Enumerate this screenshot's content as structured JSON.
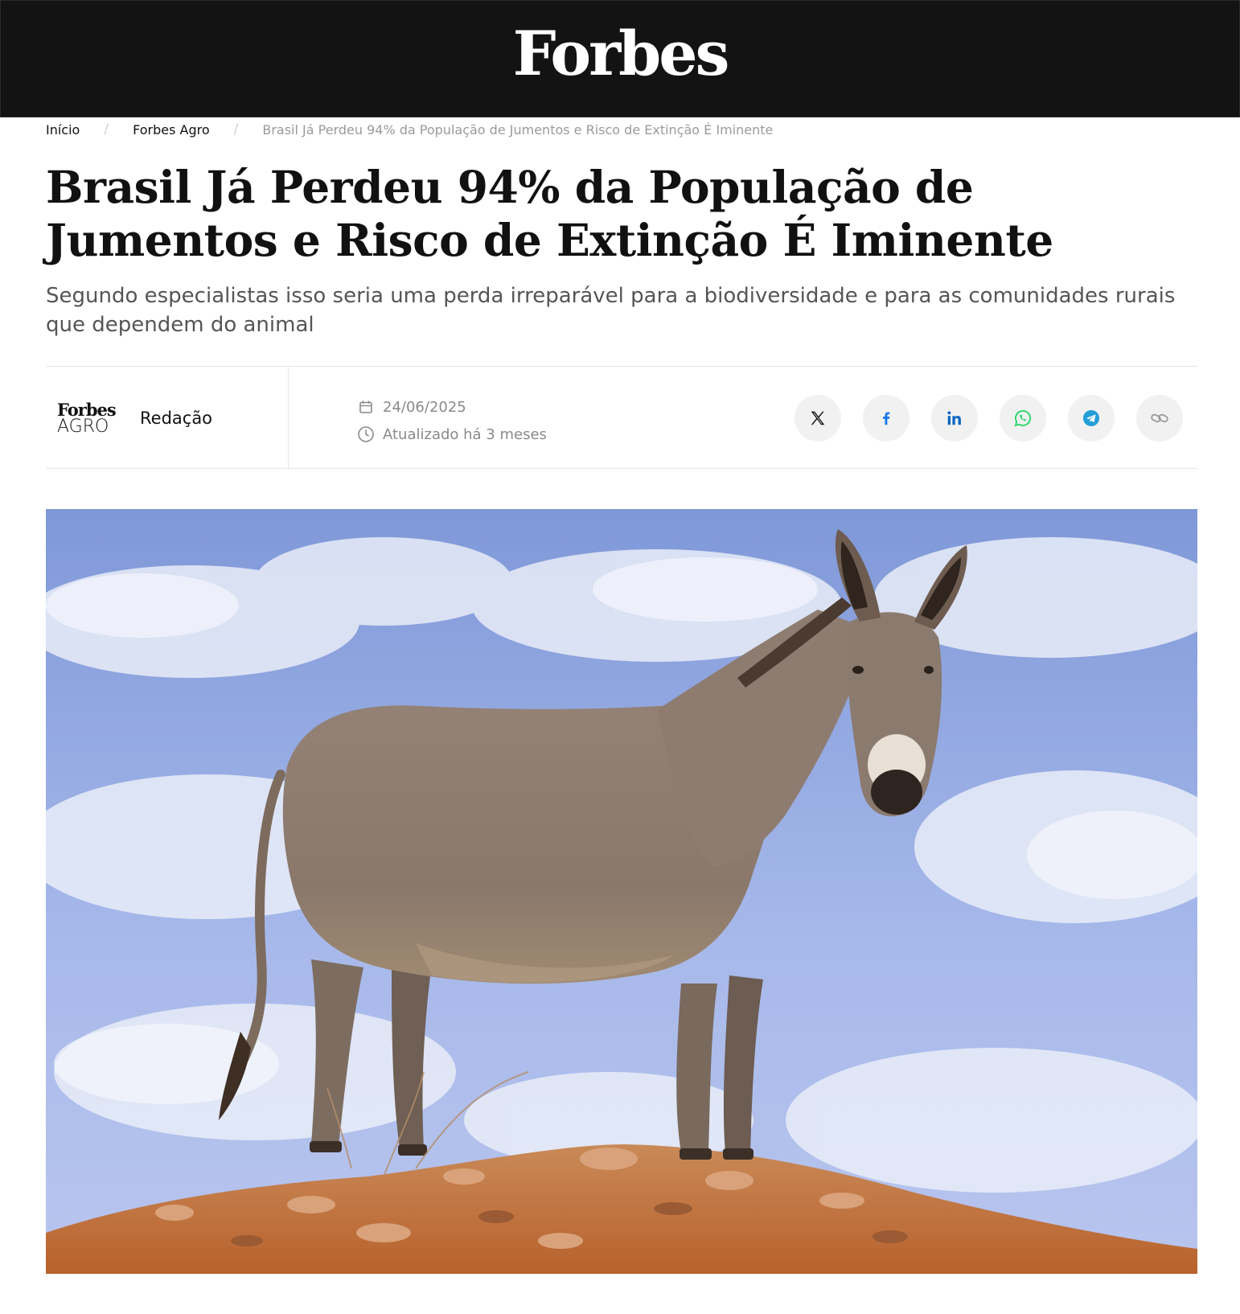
{
  "header": {
    "brand": "Forbes"
  },
  "breadcrumb": {
    "items": [
      {
        "label": "Início"
      },
      {
        "label": "Forbes Agro"
      },
      {
        "label": "Brasil Já Perdeu 94% da População de Jumentos e Risco de Extinção É Iminente"
      }
    ]
  },
  "article": {
    "title": "Brasil Já Perdeu 94% da População de Jumentos e Risco de Extinção É Iminente",
    "subtitle": "Segundo especialistas isso seria uma perda irreparável para a biodiversidade e para as comunidades rurais que dependem do animal",
    "author_logo_line1": "Forbes",
    "author_logo_line2": "AGRO",
    "author": "Redação",
    "date": "24/06/2025",
    "updated": "Atualizado há 3 meses"
  },
  "share": [
    {
      "icon": "x-icon",
      "color": "#111111"
    },
    {
      "icon": "facebook-icon",
      "color": "#1877f2"
    },
    {
      "icon": "linkedin-icon",
      "color": "#0a66c2"
    },
    {
      "icon": "whatsapp-icon",
      "color": "#25d366"
    },
    {
      "icon": "telegram-icon",
      "color": "#229ed9"
    },
    {
      "icon": "link-icon",
      "color": "#9a9a9a"
    }
  ],
  "colors": {
    "topbar": "#131313",
    "sky": "#9fb3e8",
    "ground": "#c8743e",
    "donkey": "#8c7c70"
  }
}
